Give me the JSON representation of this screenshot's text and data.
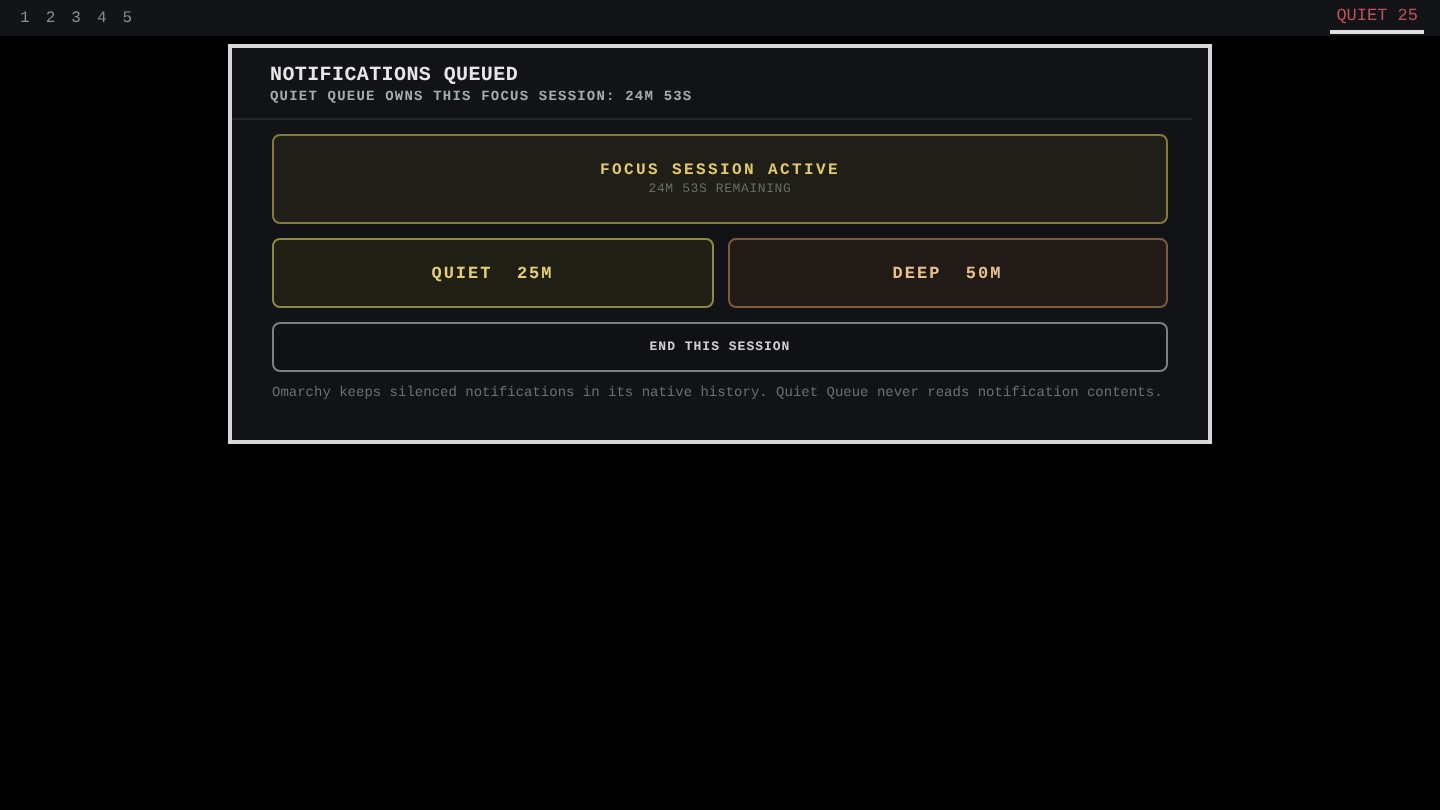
{
  "top_bar": {
    "workspaces": [
      "1",
      "2",
      "3",
      "4",
      "5"
    ],
    "indicator": {
      "label": "QUIET 25",
      "active": true
    }
  },
  "dialog": {
    "title": "NOTIFICATIONS QUEUED",
    "subtitle": "QUIET QUEUE OWNS THIS FOCUS SESSION: 24M 53S",
    "status": {
      "title": "FOCUS SESSION ACTIVE",
      "detail": "24M 53S REMAINING"
    },
    "modes": [
      {
        "kind": "quiet",
        "label": "QUIET",
        "duration": "25M"
      },
      {
        "kind": "deep",
        "label": "DEEP",
        "duration": "50M"
      }
    ],
    "end_button": "END THIS SESSION",
    "note": "Omarchy keeps silenced notifications in its native history. Quiet Queue never reads notification contents."
  }
}
